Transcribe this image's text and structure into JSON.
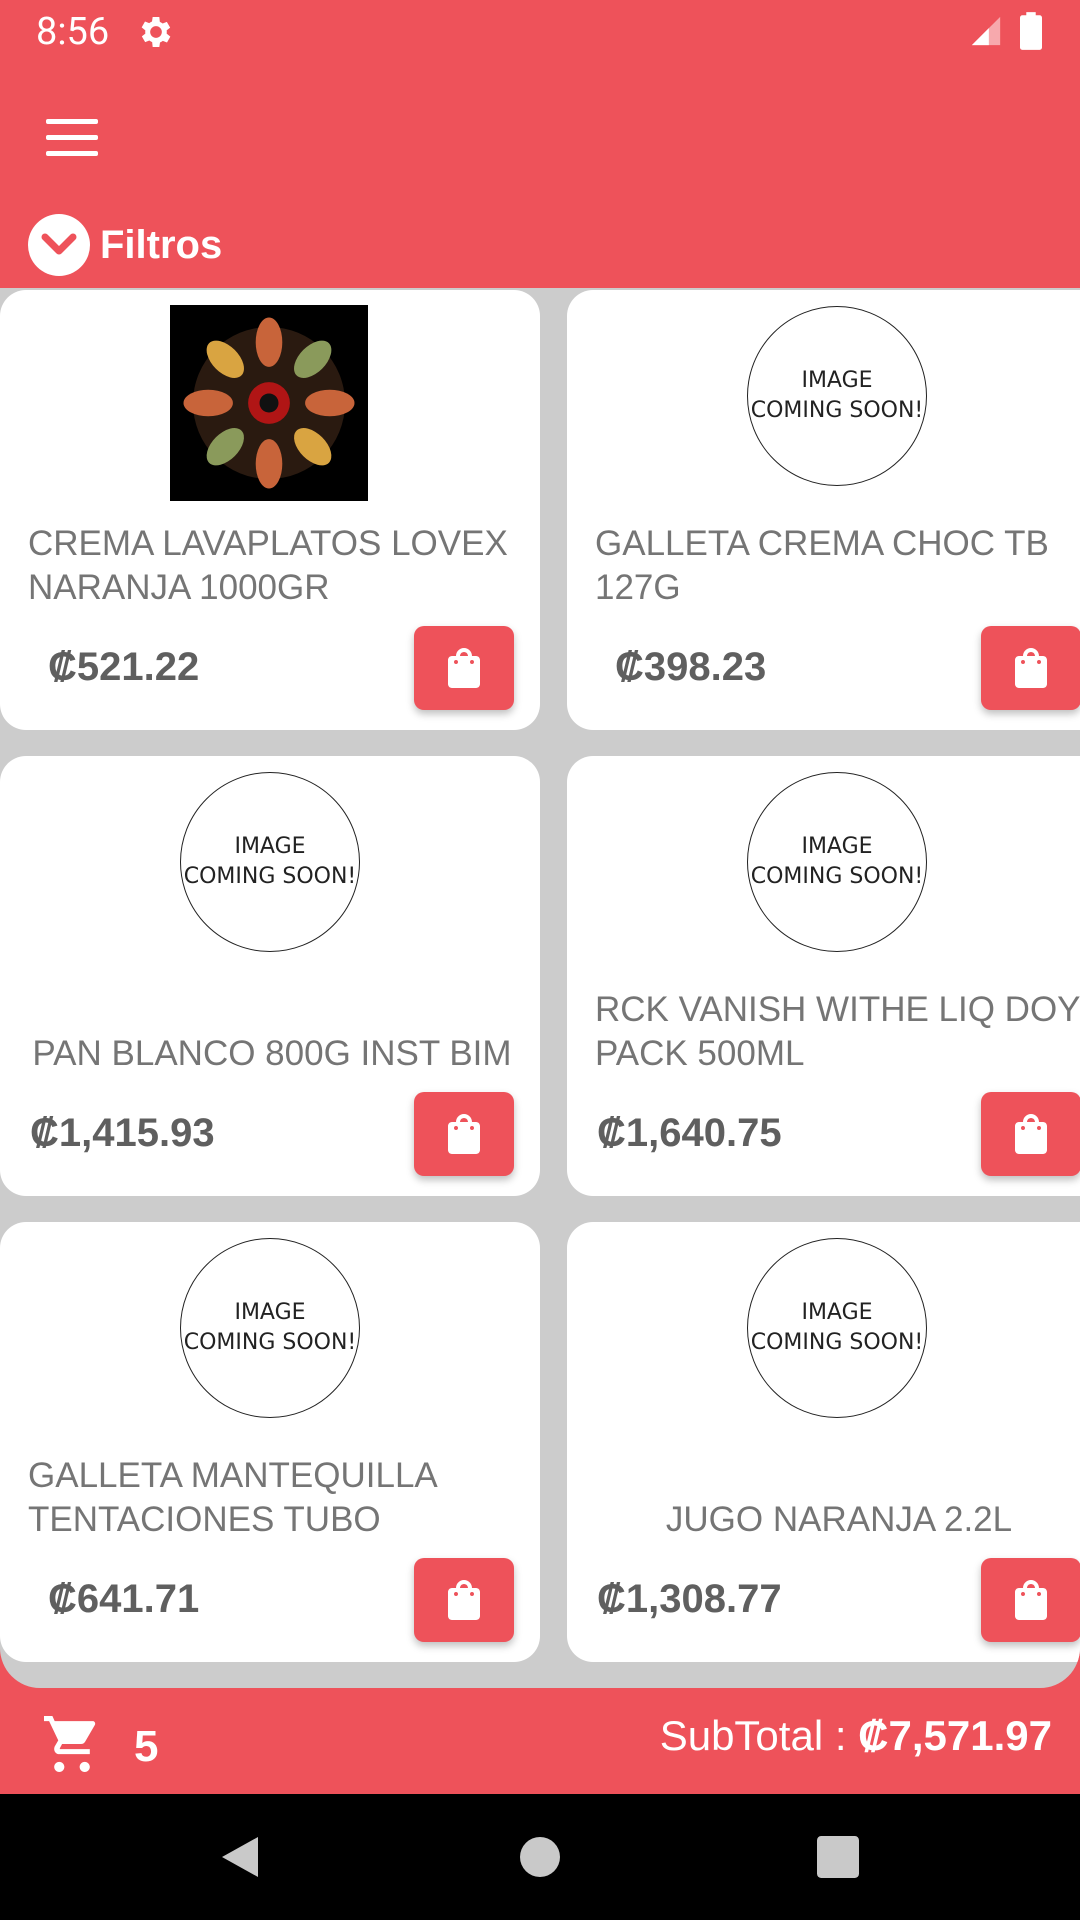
{
  "status_bar": {
    "time": "8:56"
  },
  "header": {
    "filters_label": "Filtros"
  },
  "products": [
    {
      "name": "CREMA LAVAPLATOS LOVEX NARANJA 1000GR",
      "price": "₡521.22",
      "image": "photo"
    },
    {
      "name": "GALLETA CREMA CHOC TB 127G",
      "price": "₡398.23",
      "image": "placeholder"
    },
    {
      "name": "PAN BLANCO 800G INST BIM",
      "price": "₡1,415.93",
      "image": "placeholder"
    },
    {
      "name": "RCK VANISH WITHE LIQ DOY PACK 500ML",
      "price": "₡1,640.75",
      "image": "placeholder"
    },
    {
      "name": "GALLETA MANTEQUILLA TENTACIONES TUBO",
      "price": "₡641.71",
      "image": "placeholder"
    },
    {
      "name": "JUGO NARANJA 2.2L",
      "price": "₡1,308.77",
      "image": "placeholder"
    }
  ],
  "placeholder": {
    "line1": "IMAGE",
    "line2": "COMING SOON!"
  },
  "cart": {
    "count": "5",
    "subtotal_label": "SubTotal : ",
    "subtotal_value": "₡7,571.97"
  },
  "icons": {
    "status": [
      "gear-icon",
      "signal-icon",
      "battery-icon"
    ],
    "header": [
      "menu-icon",
      "chevron-down-icon"
    ],
    "cards": "shopping-bag-icon",
    "bottom": "cart-icon",
    "nav": [
      "back-icon",
      "home-icon",
      "recents-icon"
    ]
  },
  "colors": {
    "primary": "#ee525a",
    "background": "#cccccc",
    "card": "#ffffff",
    "text": "#757575"
  }
}
